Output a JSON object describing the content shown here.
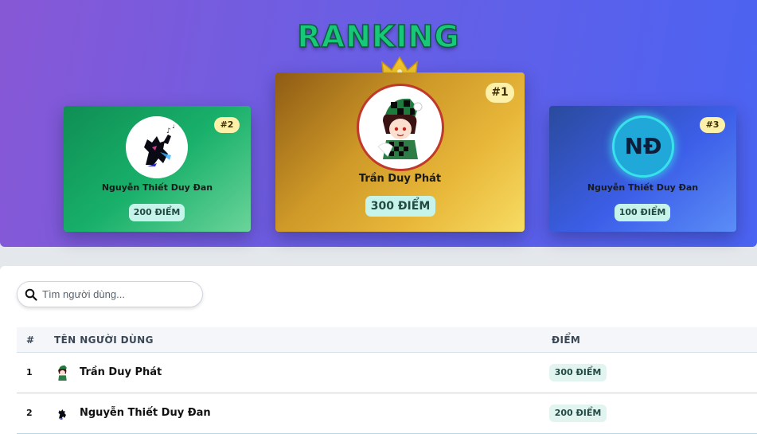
{
  "hero": {
    "title": "RANKING"
  },
  "podium": {
    "first": {
      "rank": "#1",
      "name": "Trần Duy Phát",
      "score": "300 ĐIỂM",
      "avatar": "anime-boy-avatar"
    },
    "second": {
      "rank": "#2",
      "name": "Nguyễn Thiết Duy Đan",
      "score": "200 ĐIỂM",
      "avatar": "black-cat-avatar"
    },
    "third": {
      "rank": "#3",
      "name": "Nguyễn Thiết Duy Đan",
      "score": "100 ĐIỂM",
      "initials": "NĐ"
    }
  },
  "search": {
    "placeholder": "Tìm người dùng..."
  },
  "table": {
    "headers": {
      "rank": "#",
      "user": "TÊN NGƯỜI DÙNG",
      "points": "ĐIỂM"
    },
    "rows": [
      {
        "rank": "1",
        "name": "Trần Duy Phát",
        "points": "300 ĐIỂM",
        "avatar": "anime-boy-avatar"
      },
      {
        "rank": "2",
        "name": "Nguyễn Thiết Duy Đan",
        "points": "200 ĐIỂM",
        "avatar": "black-cat-avatar"
      }
    ]
  },
  "colors": {
    "title_green": "#17c879",
    "gold": "#e8b83a",
    "green_card": "#18b06a",
    "blue_card": "#3c5ee8",
    "badge_yellow": "#fdf0a8",
    "score_mint": "#c6f4ea"
  }
}
